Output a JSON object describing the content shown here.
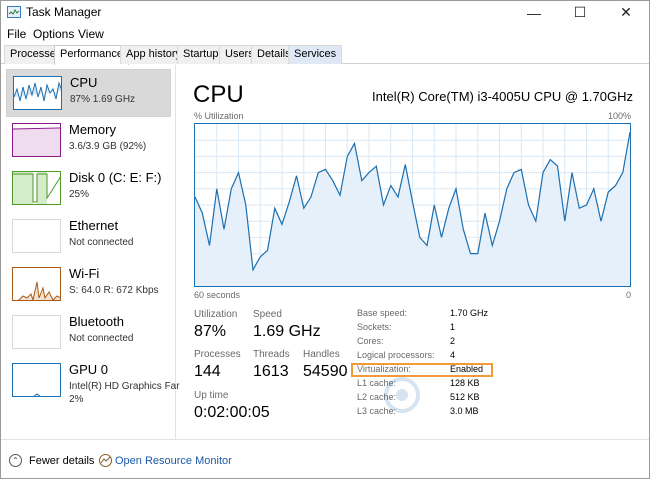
{
  "window": {
    "title": "Task Manager"
  },
  "menu": [
    "File",
    "Options",
    "View"
  ],
  "tabs": [
    "Processes",
    "Performance",
    "App history",
    "Startup",
    "Users",
    "Details",
    "Services"
  ],
  "sidebar": [
    {
      "name": "CPU",
      "sub": "87%  1.69 GHz",
      "sub2": ""
    },
    {
      "name": "Memory",
      "sub": "3.6/3.9 GB (92%)",
      "sub2": ""
    },
    {
      "name": "Disk 0 (C: E: F:)",
      "sub": "25%",
      "sub2": ""
    },
    {
      "name": "Ethernet",
      "sub": "Not connected",
      "sub2": ""
    },
    {
      "name": "Wi-Fi",
      "sub": "S: 64.0  R: 672 Kbps",
      "sub2": ""
    },
    {
      "name": "Bluetooth",
      "sub": "Not connected",
      "sub2": ""
    },
    {
      "name": "GPU 0",
      "sub": "Intel(R) HD Graphics Far",
      "sub2": "2%"
    }
  ],
  "main": {
    "title": "CPU",
    "model": "Intel(R) Core(TM) i3-4005U CPU @ 1.70GHz",
    "graph": {
      "top_left": "% Utilization",
      "top_right": "100%",
      "bottom_left": "60 seconds",
      "bottom_right": "0"
    },
    "stats": {
      "utilization_label": "Utilization",
      "utilization": "87%",
      "speed_label": "Speed",
      "speed": "1.69 GHz",
      "processes_label": "Processes",
      "processes": "144",
      "threads_label": "Threads",
      "threads": "1613",
      "handles_label": "Handles",
      "handles": "54590",
      "uptime_label": "Up time",
      "uptime": "0:02:00:05"
    },
    "specs": [
      {
        "k": "Base speed:",
        "v": "1.70 GHz"
      },
      {
        "k": "Sockets:",
        "v": "1"
      },
      {
        "k": "Cores:",
        "v": "2"
      },
      {
        "k": "Logical processors:",
        "v": "4"
      },
      {
        "k": "Virtualization:",
        "v": "Enabled"
      },
      {
        "k": "L1 cache:",
        "v": "128 KB"
      },
      {
        "k": "L2 cache:",
        "v": "512 KB"
      },
      {
        "k": "L3 cache:",
        "v": "3.0 MB"
      }
    ]
  },
  "footer": {
    "fewer_details": "Fewer details",
    "open_resmon": "Open Resource Monitor"
  },
  "colors": {
    "cpu": "#1c6fb0",
    "memory": "#8b1a8b",
    "disk": "#4c9a2a",
    "wifi": "#a85a14",
    "gpu": "#1c6fb0",
    "highlight": "#f09a3a"
  },
  "chart_data": {
    "type": "area",
    "x": [
      60,
      59,
      58,
      57,
      56,
      55,
      54,
      53,
      52,
      51,
      50,
      49,
      48,
      47,
      46,
      45,
      44,
      43,
      42,
      41,
      40,
      39,
      38,
      37,
      36,
      35,
      34,
      33,
      32,
      31,
      30,
      29,
      28,
      27,
      26,
      25,
      24,
      23,
      22,
      21,
      20,
      19,
      18,
      17,
      16,
      15,
      14,
      13,
      12,
      11,
      10,
      9,
      8,
      7,
      6,
      5,
      4,
      3,
      2,
      1,
      0
    ],
    "values": [
      55,
      45,
      25,
      60,
      35,
      60,
      70,
      50,
      10,
      18,
      22,
      48,
      38,
      52,
      68,
      48,
      55,
      70,
      72,
      65,
      56,
      80,
      88,
      65,
      70,
      74,
      50,
      62,
      55,
      75,
      52,
      30,
      25,
      50,
      30,
      48,
      60,
      35,
      20,
      20,
      45,
      25,
      40,
      60,
      70,
      72,
      50,
      40,
      70,
      78,
      74,
      40,
      70,
      48,
      50,
      60,
      40,
      58,
      62,
      70,
      95
    ],
    "ylim": [
      0,
      100
    ]
  }
}
